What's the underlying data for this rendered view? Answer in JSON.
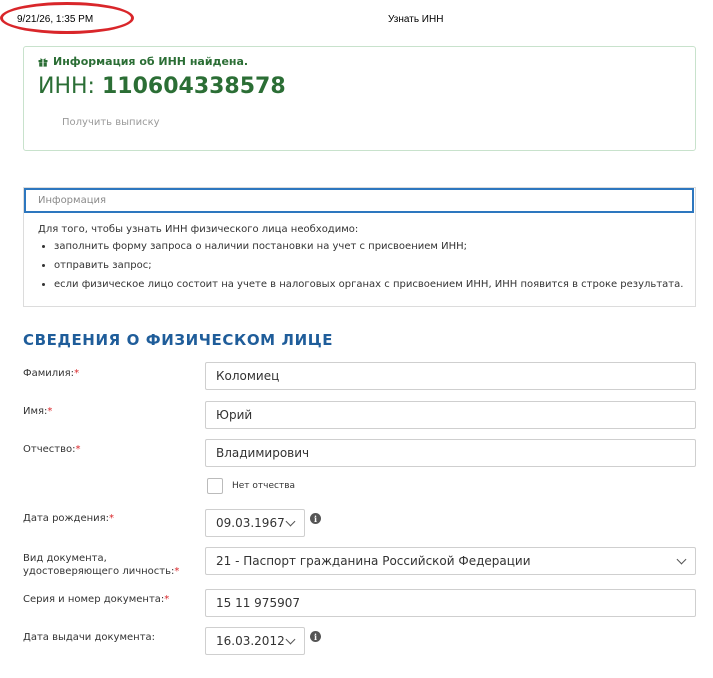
{
  "header": {
    "print_date": "9/21/26, 1:35 PM",
    "page_title": "Узнать ИНН"
  },
  "result": {
    "found_message": "Информация об ИНН найдена.",
    "inn_label": "ИНН:",
    "inn_value": "110604338578",
    "extract_link": "Получить выписку"
  },
  "info": {
    "tab_label": "Информация",
    "intro": "Для того, чтобы узнать ИНН физического лица необходимо:",
    "steps": [
      "заполнить форму запроса о наличии постановки на учет с присвоением ИНН;",
      "отправить запрос;",
      "если физическое лицо состоит на учете в налоговых органах с присвоением ИНН, ИНН появится в строке результата."
    ]
  },
  "form": {
    "section_title": "СВЕДЕНИЯ О ФИЗИЧЕСКОМ ЛИЦЕ",
    "required_mark": "*",
    "surname": {
      "label": "Фамилия:",
      "value": "Коломиец"
    },
    "name": {
      "label": "Имя:",
      "value": "Юрий"
    },
    "patronymic": {
      "label": "Отчество:",
      "value": "Владимирович"
    },
    "no_patronymic_label": "Нет отчества",
    "birth_date": {
      "label": "Дата рождения:",
      "value": "09.03.1967"
    },
    "doc_type": {
      "label_line1": "Вид документа,",
      "label_line2": "удостоверяющего личность:",
      "value": "21 - Паспорт гражданина Российской Федерации"
    },
    "doc_number": {
      "label": "Серия и номер документа:",
      "value": "15 11 975907"
    },
    "issue_date": {
      "label": "Дата выдачи документа:",
      "value": "16.03.2012"
    }
  },
  "colors": {
    "success_green": "#2b6e35",
    "accent_blue": "#2d77bf",
    "title_blue": "#1f5d9a",
    "required_red": "#d9262a"
  }
}
